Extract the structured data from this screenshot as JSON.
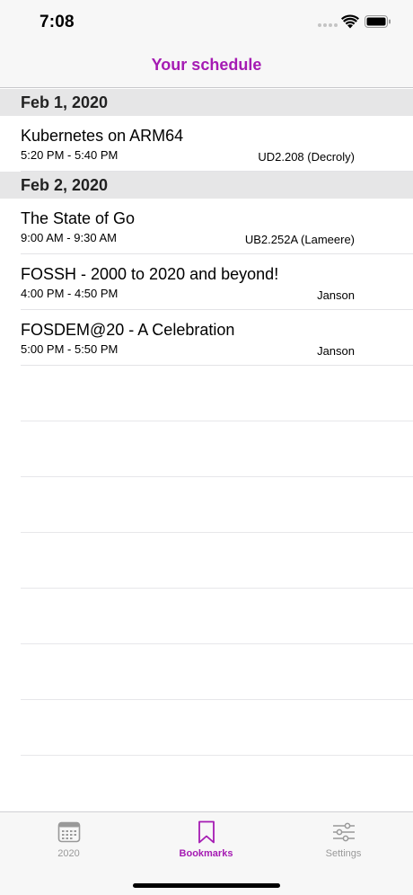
{
  "status_bar": {
    "time": "7:08"
  },
  "nav": {
    "title": "Your schedule"
  },
  "sections": [
    {
      "date": "Feb 1, 2020",
      "events": [
        {
          "title": "Kubernetes on ARM64",
          "time": "5:20 PM - 5:40 PM",
          "room": "UD2.208 (Decroly)"
        }
      ]
    },
    {
      "date": "Feb 2, 2020",
      "events": [
        {
          "title": "The State of Go",
          "time": "9:00 AM - 9:30 AM",
          "room": "UB2.252A (Lameere)"
        },
        {
          "title": "FOSSH - 2000 to 2020 and beyond!",
          "time": "4:00 PM - 4:50 PM",
          "room": "Janson"
        },
        {
          "title": "FOSDEM@20 - A Celebration",
          "time": "5:00 PM - 5:50 PM",
          "room": "Janson"
        }
      ]
    }
  ],
  "tabs": [
    {
      "label": "2020",
      "icon": "calendar-icon",
      "active": false
    },
    {
      "label": "Bookmarks",
      "icon": "bookmark-icon",
      "active": true
    },
    {
      "label": "Settings",
      "icon": "sliders-icon",
      "active": false
    }
  ],
  "colors": {
    "accent": "#a51bb3",
    "section_bg": "#e6e6e7",
    "bar_bg": "#f7f7f7",
    "inactive": "#999999"
  }
}
